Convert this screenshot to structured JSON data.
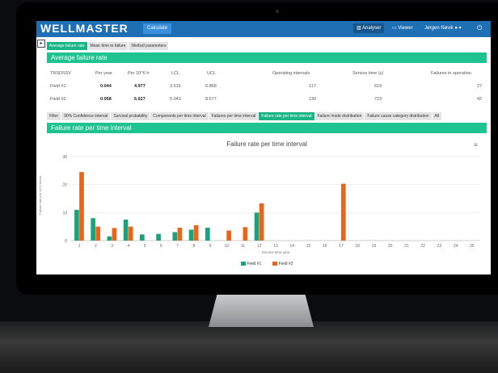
{
  "app": {
    "logo": "WELLMASTER",
    "calculate_label": "Calculate"
  },
  "nav": {
    "analyser": "Analyser",
    "viewer": "Viewer",
    "user": "Jørgen Nøvik",
    "power_icon": "power-icon"
  },
  "top_tabs": [
    {
      "label": "Average failure rate",
      "active": true
    },
    {
      "label": "Mean time to failure",
      "active": false
    },
    {
      "label": "Weibull parameters",
      "active": false
    }
  ],
  "avg_section": {
    "title": "Average failure rate"
  },
  "table": {
    "headers": [
      "TRSDSSV",
      "Per year",
      "Per 10^6 h",
      "LCL",
      "UCL",
      "Operating intervals",
      "Service time (y)",
      "Failures in operation"
    ],
    "rows": [
      [
        "Field #1",
        "0.044",
        "4.977",
        "3.515",
        "6.868",
        "117",
        "619",
        "27"
      ],
      [
        "Field #2",
        "0.058",
        "6.627",
        "5.043",
        "8.577",
        "130",
        "723",
        "42"
      ]
    ]
  },
  "sub_tabs": [
    {
      "label": "Filter",
      "active": false
    },
    {
      "label": "90% Confidence interval",
      "active": false
    },
    {
      "label": "Survival probability",
      "active": false
    },
    {
      "label": "Components per time interval",
      "active": false
    },
    {
      "label": "Failures per time interval",
      "active": false
    },
    {
      "label": "Failure rate per time interval",
      "active": true
    },
    {
      "label": "Failure mode distribution",
      "active": false
    },
    {
      "label": "Failure cause category distribution",
      "active": false
    },
    {
      "label": "All",
      "active": false
    }
  ],
  "rate_section": {
    "title": "Failure rate per time interval"
  },
  "chart_data": {
    "type": "bar",
    "title": "Failure rate per time interval",
    "xlabel": "Service time year",
    "ylabel": "Failure rate per 10^6 hours",
    "ylim": [
      0,
      30
    ],
    "yticks": [
      0,
      10,
      20,
      30
    ],
    "categories": [
      "1",
      "2",
      "3",
      "4",
      "5",
      "6",
      "7",
      "8",
      "9",
      "10",
      "11",
      "12",
      "13",
      "14",
      "15",
      "16",
      "17",
      "18",
      "19",
      "20",
      "21",
      "22",
      "23",
      "24",
      "25"
    ],
    "series": [
      {
        "name": "Field #1",
        "color": "#1aa37a",
        "values": [
          11,
          8,
          1.5,
          7.5,
          2.2,
          2.4,
          3,
          3.9,
          4.6,
          0,
          0,
          10,
          0,
          0,
          0,
          0,
          0,
          0,
          0,
          0,
          0,
          0,
          0,
          0,
          0
        ]
      },
      {
        "name": "Field #2",
        "color": "#e8661c",
        "values": [
          24.5,
          5,
          4.5,
          5,
          0,
          0,
          4.6,
          5.5,
          0,
          3.6,
          4.8,
          13.3,
          0,
          0,
          0,
          0,
          20.3,
          0,
          0,
          0,
          0,
          0,
          0,
          0,
          0
        ]
      }
    ],
    "grid": true,
    "legend": "bottom-center"
  }
}
